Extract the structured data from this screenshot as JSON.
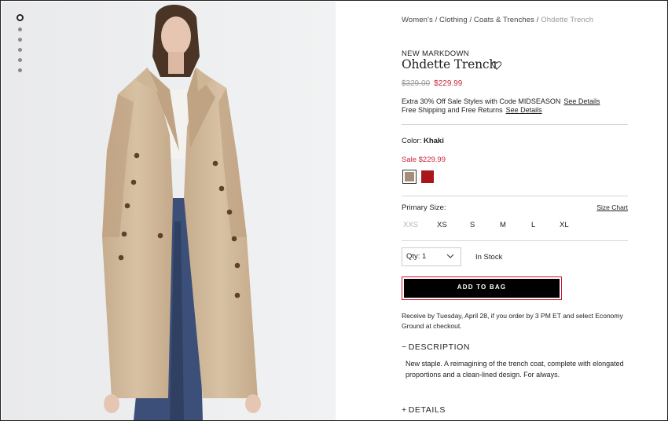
{
  "gallery": {
    "image_alt": "Model wearing Ohdette Trench in Khaki",
    "dots": [
      true,
      false,
      false,
      false,
      false,
      false
    ]
  },
  "breadcrumb": {
    "items": [
      "Women's",
      "Clothing",
      "Coats & Trenches"
    ],
    "separator": " / ",
    "current": "Ohdette Trench"
  },
  "product": {
    "badge": "NEW MARKDOWN",
    "title": "Ohdette Trench",
    "original_price": "$329.00",
    "sale_price": "$229.99",
    "promo_line1": "Extra 30% Off Sale Styles with Code MIDSEASON",
    "promo_line2": "Free Shipping and Free Returns",
    "see_details": "See Details"
  },
  "color": {
    "label": "Color:",
    "selected": "Khaki",
    "sale_text": "Sale $229.99",
    "swatches": [
      {
        "name": "Khaki",
        "hex": "#a48e78",
        "selected": true
      },
      {
        "name": "Red",
        "hex": "#a8161b",
        "selected": false
      }
    ]
  },
  "size": {
    "label": "Primary Size:",
    "chart_link": "Size Chart",
    "options": [
      {
        "label": "XXS",
        "available": false
      },
      {
        "label": "XS",
        "available": true
      },
      {
        "label": "S",
        "available": true
      },
      {
        "label": "M",
        "available": true
      },
      {
        "label": "L",
        "available": true
      },
      {
        "label": "XL",
        "available": true
      }
    ]
  },
  "purchase": {
    "qty_label": "Qty: 1",
    "stock": "In Stock",
    "add_to_bag": "ADD TO BAG",
    "delivery": "Receive by Tuesday, April 28, if you order by 3 PM ET and select Economy Ground at checkout."
  },
  "sections": {
    "description_sign": "−",
    "description_title": "DESCRIPTION",
    "description_text": "New staple. A reimagining of the trench coat, complete with elongated proportions and a clean-lined design. For always.",
    "details_sign": "+",
    "details_title": "DETAILS"
  },
  "colors": {
    "sale_red": "#c8283a",
    "button_bg": "#000000",
    "button_outline": "#d3122a"
  }
}
